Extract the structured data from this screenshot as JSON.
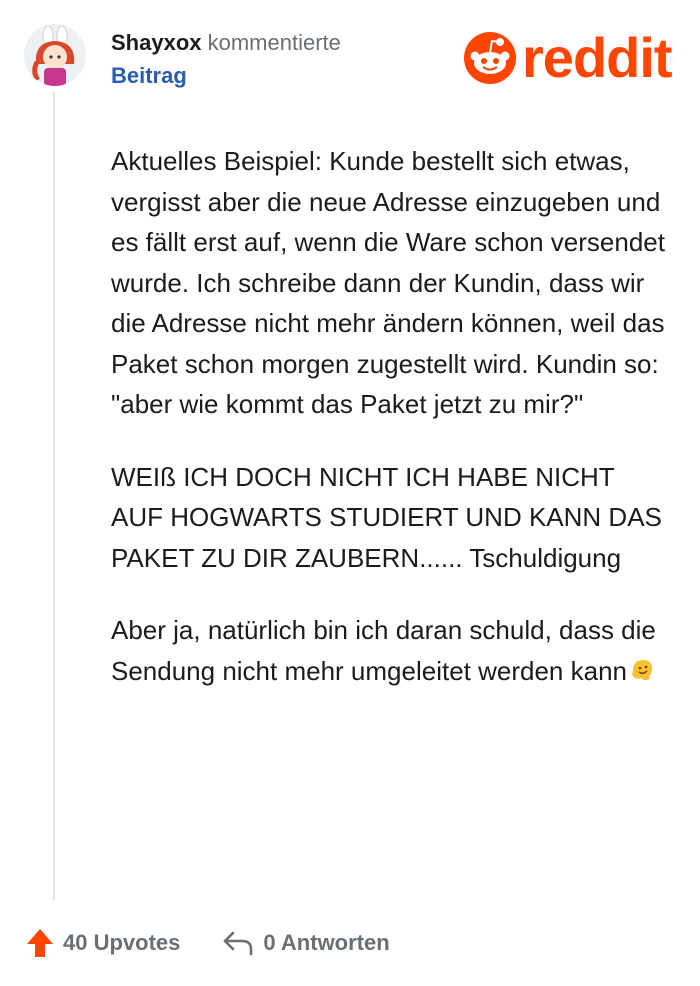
{
  "comment": {
    "author": "Shayxox",
    "action": "kommentierte",
    "post_link": "Beitrag",
    "paragraphs": [
      "Aktuelles Beispiel: Kunde bestellt sich etwas, vergisst aber die neue Adresse einzugeben und es fällt erst auf, wenn die Ware schon versendet wurde. Ich schreibe dann der Kundin, dass wir die Adresse nicht mehr ändern können, weil das Paket schon morgen zugestellt wird. Kundin so: \"aber wie kommt das Paket jetzt zu mir?\"",
      "WEIß ICH DOCH NICHT ICH HABE NICHT AUF HOGWARTS STUDIERT UND KANN DAS PAKET ZU DIR ZAUBERN...... Tschuldigung",
      "Aber ja, natürlich bin ich daran schuld, dass die Sendung nicht mehr umgeleitet werden kann"
    ],
    "trailing_emoji": "melting-face-emoji"
  },
  "brand": {
    "name": "reddit",
    "color": "#ff4500"
  },
  "footer": {
    "upvotes": "40 Upvotes",
    "replies": "0 Antworten"
  },
  "colors": {
    "link": "#2a5db0",
    "muted": "#6a6f73",
    "upvote": "#ff4500",
    "thread_line": "#e2e5e7"
  }
}
